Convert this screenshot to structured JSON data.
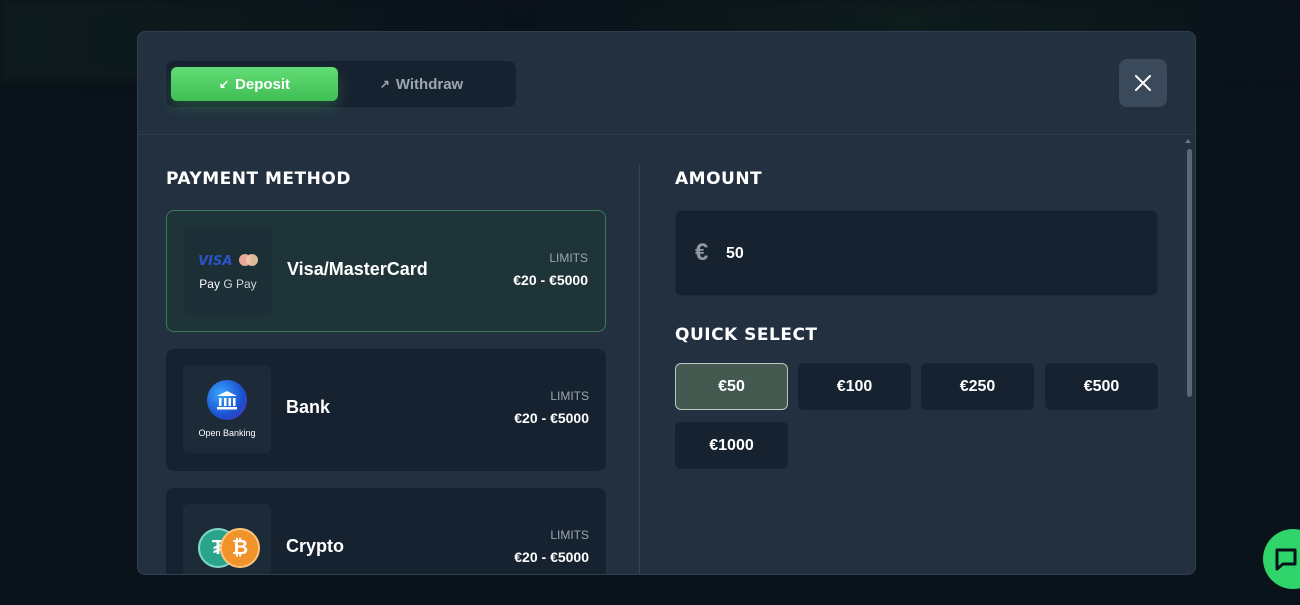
{
  "tabs": [
    {
      "label": "Deposit",
      "icon": "arrow-down-left-icon",
      "active": true
    },
    {
      "label": "Withdraw",
      "icon": "arrow-up-right-icon",
      "active": false
    }
  ],
  "close_icon": "close-icon",
  "payment": {
    "title": "PAYMENT METHOD",
    "methods": [
      {
        "name": "Visa/MasterCard",
        "limits_label": "LIMITS",
        "limits": "€20 - €5000",
        "selected": true,
        "logo_text": {
          "visa": "VISA",
          "apple_pay": "Pay",
          "google_pay": "G Pay"
        }
      },
      {
        "name": "Bank",
        "limits_label": "LIMITS",
        "limits": "€20 - €5000",
        "selected": false,
        "logo_text": {
          "caption": "Open Banking"
        }
      },
      {
        "name": "Crypto",
        "limits_label": "LIMITS",
        "limits": "€20 - €5000",
        "selected": false,
        "logo_text": {}
      }
    ]
  },
  "amount": {
    "title": "AMOUNT",
    "currency": "€",
    "value": "50"
  },
  "quick_select": {
    "title": "QUICK SELECT",
    "options": [
      "€50",
      "€100",
      "€250",
      "€500",
      "€1000"
    ],
    "selected": "€50"
  },
  "colors": {
    "accent_green": "#4fcf64",
    "modal_bg": "#22303f",
    "card_bg": "#172230",
    "chat_green": "#2fd46a"
  }
}
